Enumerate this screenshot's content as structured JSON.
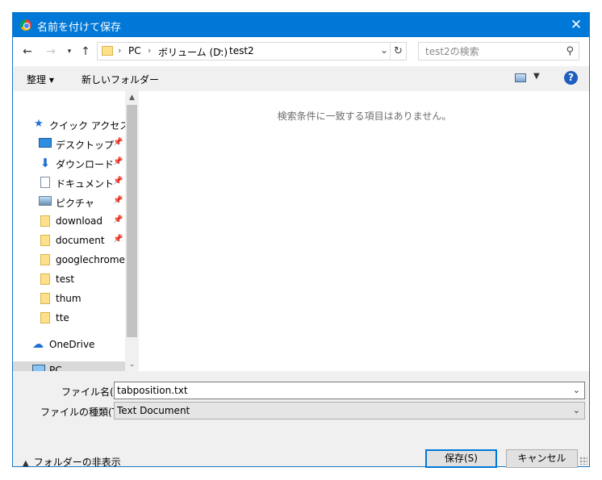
{
  "window": {
    "title": "名前を付けて保存"
  },
  "address": {
    "segments": [
      "PC",
      "ボリューム (D:)",
      "test2"
    ]
  },
  "search": {
    "placeholder": "test2の検索"
  },
  "commands": {
    "organize": "整理 ▾",
    "new_folder": "新しいフォルダー"
  },
  "sidebar": {
    "quick_access": "クイック アクセス",
    "items": [
      {
        "label": "デスクトップ",
        "icon": "desktop-icon",
        "pinned": true
      },
      {
        "label": "ダウンロード",
        "icon": "download-icon",
        "pinned": true
      },
      {
        "label": "ドキュメント",
        "icon": "document-icon",
        "pinned": true
      },
      {
        "label": "ピクチャ",
        "icon": "picture-icon",
        "pinned": true
      },
      {
        "label": "download",
        "icon": "folder-icon",
        "pinned": true
      },
      {
        "label": "document",
        "icon": "folder-icon",
        "pinned": true
      },
      {
        "label": "googlechrome",
        "icon": "folder-icon",
        "pinned": false
      },
      {
        "label": "test",
        "icon": "folder-icon",
        "pinned": false
      },
      {
        "label": "thum",
        "icon": "folder-icon",
        "pinned": false
      },
      {
        "label": "tte",
        "icon": "folder-icon",
        "pinned": false
      }
    ],
    "onedrive": "OneDrive",
    "pc": "PC"
  },
  "content": {
    "empty_message": "検索条件に一致する項目はありません。"
  },
  "form": {
    "filename_label": "ファイル名(N):",
    "filename_value": "tabposition.txt",
    "filetype_label": "ファイルの種類(T):",
    "filetype_value": "Text Document"
  },
  "footer": {
    "hide_folders": "フォルダーの非表示",
    "save": "保存(S)",
    "cancel": "キャンセル"
  },
  "colors": {
    "titlebar": "#0078d7",
    "accent": "#0078d7"
  }
}
